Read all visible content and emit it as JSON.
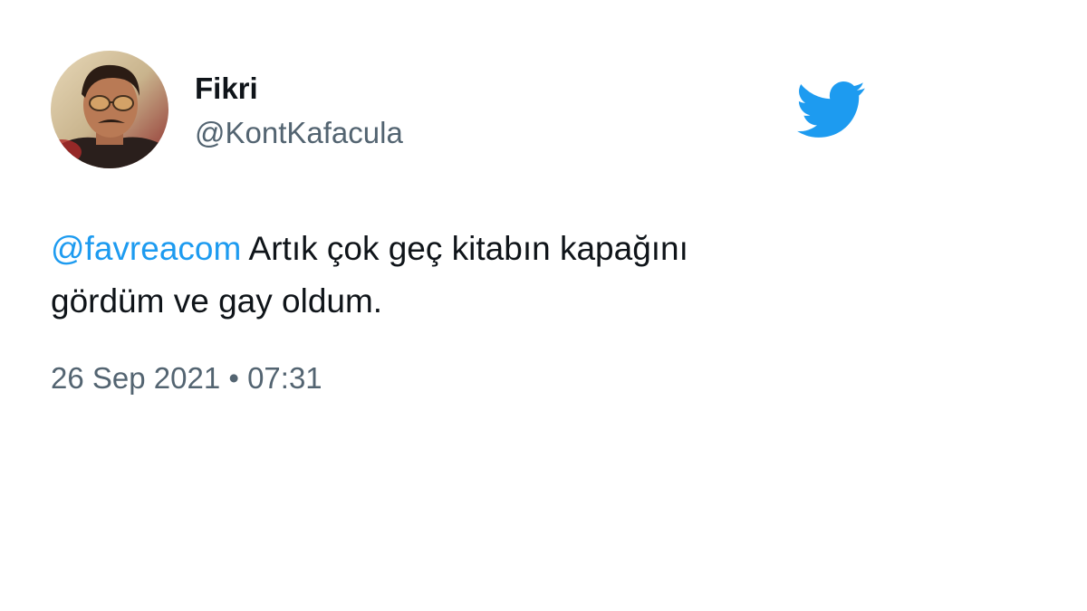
{
  "tweet": {
    "author": {
      "display_name": "Fikri",
      "handle": "@KontKafacula",
      "avatar": "avatar-photo"
    },
    "mention": "@favreacom",
    "text_line1": " Artık çok geç kitabın kapağını",
    "text_line2": "gördüm ve gay oldum.",
    "date": "26 Sep 2021",
    "separator": "•",
    "time": "07:31"
  },
  "icons": {
    "brand": "twitter-bird-icon"
  },
  "colors": {
    "brand_blue": "#1d9bf0",
    "text": "#0f1419",
    "secondary_text": "#536471",
    "background": "#ffffff"
  }
}
